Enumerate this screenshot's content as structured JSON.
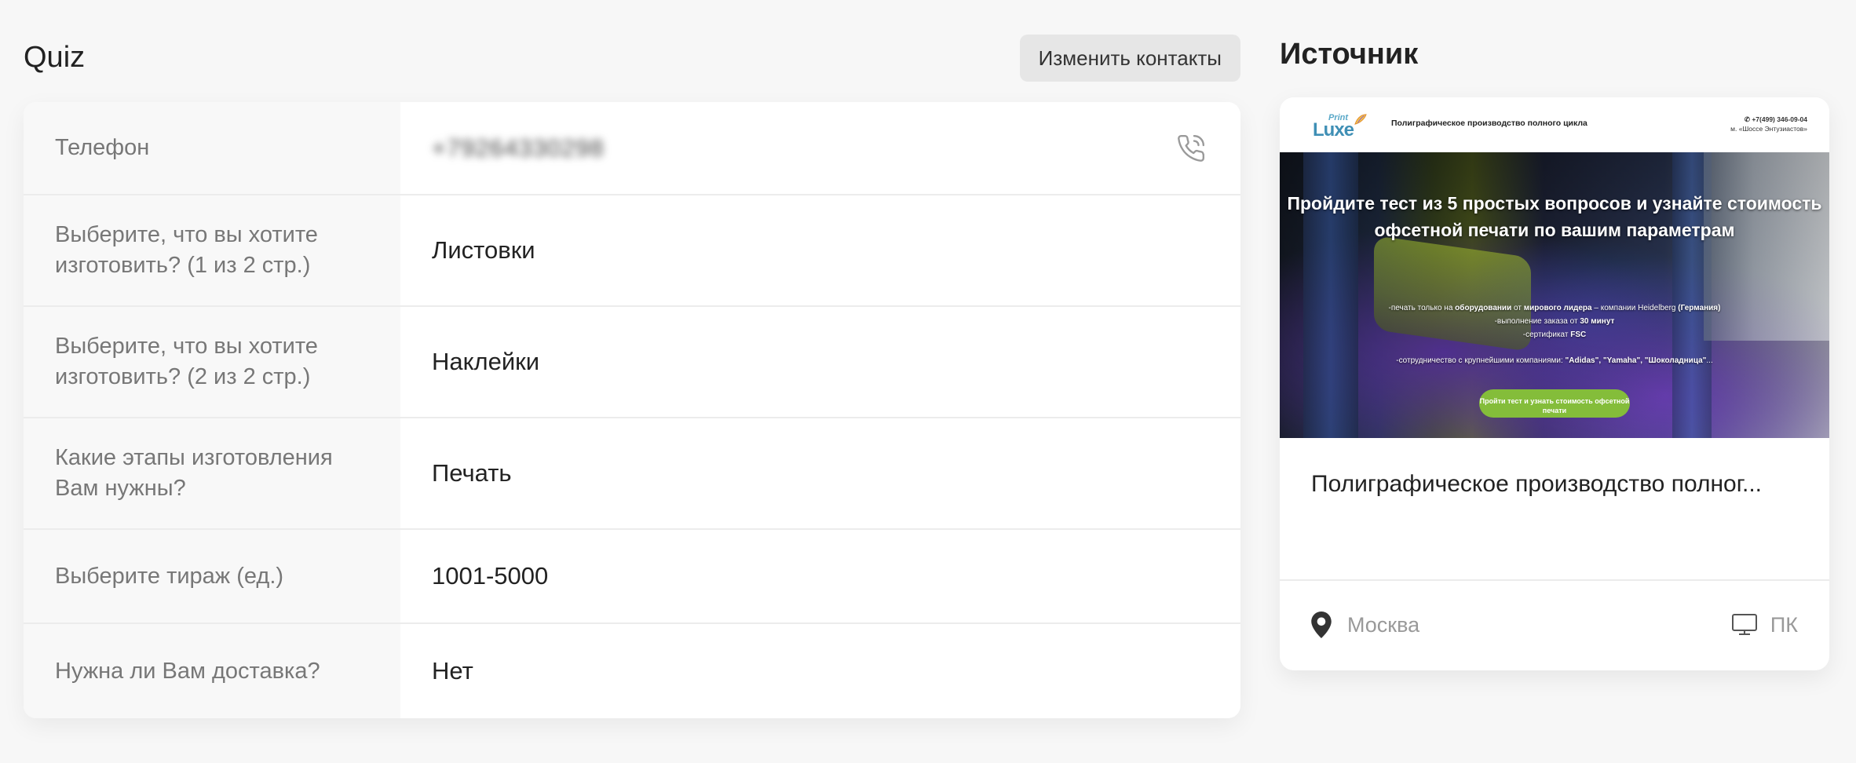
{
  "quiz": {
    "title": "Quiz",
    "edit_contacts_label": "Изменить контакты",
    "rows": [
      {
        "label": "Телефон",
        "value": "+79264330298"
      },
      {
        "label": "Выберите, что вы хотите изготовить? (1 из 2 стр.)",
        "value": "Листовки"
      },
      {
        "label": "Выберите, что вы хотите изготовить? (2 из 2 стр.)",
        "value": "Наклейки"
      },
      {
        "label": "Какие этапы изготовления Вам нужны?",
        "value": "Печать"
      },
      {
        "label": "Выберите тираж (ед.)",
        "value": "1001-5000"
      },
      {
        "label": "Нужна ли Вам доставка?",
        "value": "Нет"
      }
    ]
  },
  "source": {
    "title": "Источник",
    "preview": {
      "logo_top": "Print",
      "logo_main": "Luxe",
      "tagline": "Полиграфическое производство полного цикла",
      "phone": "+7(499) 346-09-04",
      "address": "м. «Шоссе Энтузиастов»",
      "headline": "Пройдите тест из 5 простых вопросов и узнайте стоимость офсетной печати по вашим параметрам",
      "bullet1_a": "-печать только на ",
      "bullet1_b": "оборудовании",
      "bullet1_c": " от ",
      "bullet1_d": "мирового лидера",
      "bullet1_e": " – компании Heidelberg ",
      "bullet1_f": "(Германия)",
      "bullet2_a": "-выполнение заказа от ",
      "bullet2_b": "30 минут",
      "bullet3_a": "-сертификат ",
      "bullet3_b": "FSC",
      "bullet4_a": "-сотрудничество с крупнейшими компаниями: ",
      "bullet4_b": "\"Adidas\", \"Yamaha\", \"Шоколадница\"",
      "bullet4_c": "...",
      "cta": "Пройти тест и узнать стоимость офсетной печати"
    },
    "name": "Полиграфическое производство полног...",
    "city": "Москва",
    "device": "ПК"
  },
  "colors": {
    "cta_green": "#84bd3a",
    "logo_blue": "#3f8fb5"
  },
  "icons": [
    "phone-call-icon",
    "location-pin-icon",
    "monitor-icon"
  ]
}
